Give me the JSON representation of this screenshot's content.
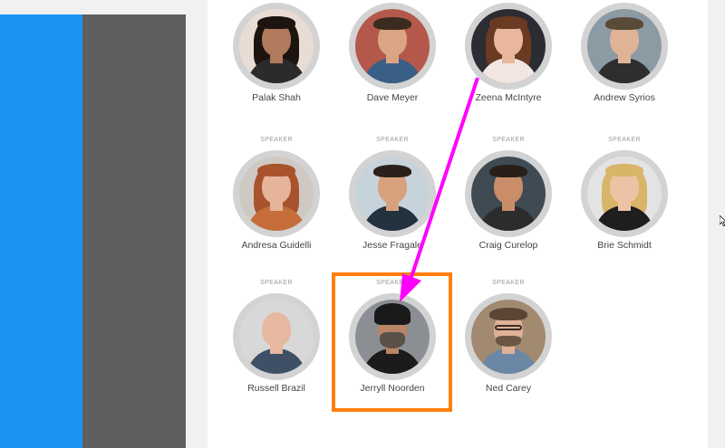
{
  "role_label": "SPEAKER",
  "speakers": [
    {
      "name": "Palak Shah",
      "skin": "#b07a5c",
      "hair": "#1d1410",
      "style": "long",
      "shirt": "#2b2b2b",
      "bg": "#e8dcd4",
      "role": false
    },
    {
      "name": "Dave Meyer",
      "skin": "#d9a583",
      "hair": "#3b2a1e",
      "style": "short",
      "shirt": "#3a5f86",
      "bg": "#b3584b",
      "role": false
    },
    {
      "name": "Zeena McIntyre",
      "skin": "#e9b79b",
      "hair": "#6a3a22",
      "style": "long",
      "shirt": "#f2e6e2",
      "bg": "#2c2c33",
      "role": false
    },
    {
      "name": "Andrew Syrios",
      "skin": "#e0b396",
      "hair": "#5a4a38",
      "style": "short",
      "shirt": "#2e2e2e",
      "bg": "#8c9aa4",
      "role": false
    },
    {
      "name": "Andresa Guidelli",
      "skin": "#e6b49a",
      "hair": "#a8532d",
      "style": "long",
      "shirt": "#c66d3c",
      "bg": "#cfc9c3",
      "role": true
    },
    {
      "name": "Jesse Fragale",
      "skin": "#d8a17e",
      "hair": "#2c211a",
      "style": "short",
      "shirt": "#24313f",
      "bg": "#c7d3da",
      "role": true
    },
    {
      "name": "Craig Curelop",
      "skin": "#c98d6a",
      "hair": "#2a1f18",
      "style": "short",
      "shirt": "#2c2c2c",
      "bg": "#3f4a52",
      "role": true
    },
    {
      "name": "Brie Schmidt",
      "skin": "#ecc3a5",
      "hair": "#d9b56a",
      "style": "long",
      "shirt": "#1e1e1e",
      "bg": "#e3e3e3",
      "role": true
    },
    {
      "name": "Russell Brazil",
      "skin": "#e7b8a0",
      "hair": "#c9a58d",
      "style": "bald",
      "shirt": "#3e4f66",
      "bg": "#d8d8d8",
      "role": true
    },
    {
      "name": "Jerryll Noorden",
      "skin": "#b98566",
      "hair": "#1a1a1a",
      "style": "turban",
      "shirt": "#1b1b1b",
      "bg": "#8b8f93",
      "role": true
    },
    {
      "name": "Ned Carey",
      "skin": "#dfb196",
      "hair": "#5b4636",
      "style": "glasses",
      "shirt": "#6c87a6",
      "bg": "#a28a70",
      "role": true
    }
  ],
  "colors": {
    "left_panel": "#1b93f3",
    "nav_panel": "#5f5f5f",
    "highlight_border": "#ff7f0e",
    "arrow": "#ff00ff"
  },
  "highlighted_speaker": "Jerryll Noorden"
}
